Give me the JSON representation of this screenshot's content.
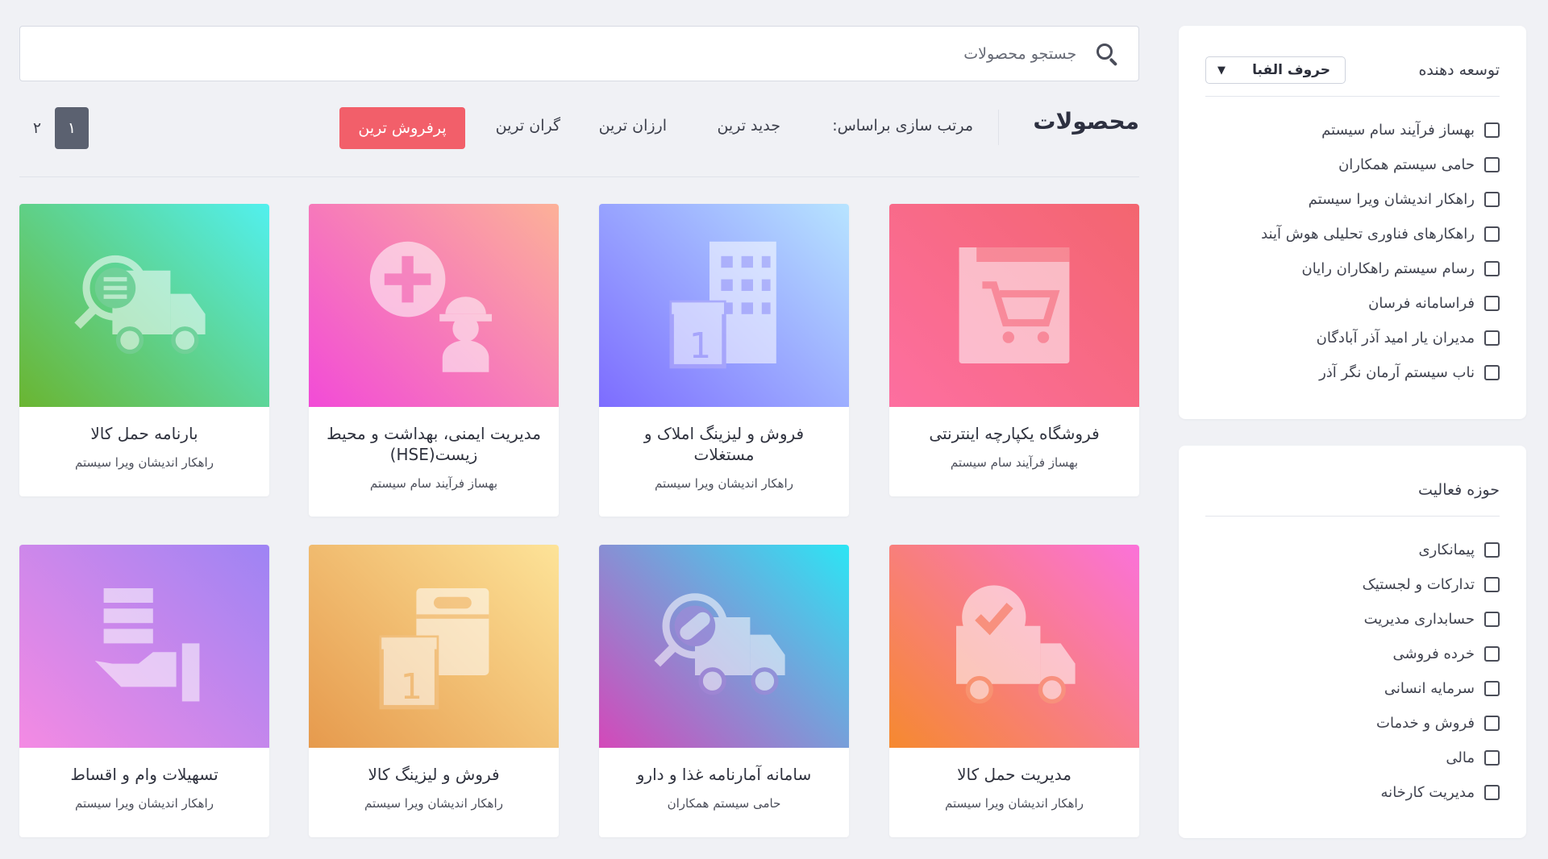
{
  "sidebar": {
    "developer": {
      "title": "توسعه دهنده",
      "sort_select": "حروف الفبا",
      "items": [
        "بهساز فرآیند سام سیستم",
        "حامی سیستم همکاران",
        "راهکار اندیشان ویرا سیستم",
        "راهکارهای فناوری تحلیلی هوش آیند",
        "رسام سیستم راهکاران رایان",
        "فراسامانه فرسان",
        "مدیران یار امید آذر آبادگان",
        "ناب سیستم آرمان نگر آذر"
      ]
    },
    "activity": {
      "title": "حوزه فعالیت",
      "items": [
        "پیمانکاری",
        "تدارکات و لجستیک",
        "حسابداری مدیریت",
        "خرده فروشی",
        "سرمایه انسانی",
        "فروش و خدمات",
        "مالی",
        "مدیریت کارخانه"
      ]
    }
  },
  "search": {
    "placeholder": "جستجو محصولات",
    "icon": "search-icon"
  },
  "toolbar": {
    "title": "محصولات",
    "sort_label": "مرتب سازی براساس:",
    "sort_newest": "جدید ترین",
    "sort_cheapest": "ارزان ترین",
    "sort_expensive": "گران ترین",
    "sort_bestseller": "پرفروش ترین",
    "page_current": "۱",
    "page_next": "۲"
  },
  "colors": {
    "accent": "#f25f6a",
    "pager_active": "#5b6170"
  },
  "products": [
    {
      "title": "فروشگاه یکپارچه اینترنتی",
      "vendor": "بهساز فرآیند سام سیستم",
      "icon": "shopping-cart-icon"
    },
    {
      "title": "فروش و لیزینگ املاک و مستغلات",
      "vendor": "راهکار اندیشان ویرا سیستم",
      "icon": "building-icon"
    },
    {
      "title": "مدیریت ایمنی، بهداشت و محیط زیست(HSE)",
      "vendor": "بهساز فرآیند سام سیستم",
      "icon": "safety-worker-icon"
    },
    {
      "title": "بارنامه حمل کالا",
      "vendor": "راهکار اندیشان ویرا سیستم",
      "icon": "truck-search-icon"
    },
    {
      "title": "مدیریت حمل کالا",
      "vendor": "راهکار اندیشان ویرا سیستم",
      "icon": "truck-check-icon"
    },
    {
      "title": "سامانه آمارنامه غذا و دارو",
      "vendor": "حامی سیستم همکاران",
      "icon": "truck-pill-icon"
    },
    {
      "title": "فروش و لیزینگ کالا",
      "vendor": "راهکار اندیشان ویرا سیستم",
      "icon": "boxes-icon"
    },
    {
      "title": "تسهیلات وام و اقساط",
      "vendor": "راهکار اندیشان ویرا سیستم",
      "icon": "hand-coins-icon"
    }
  ]
}
